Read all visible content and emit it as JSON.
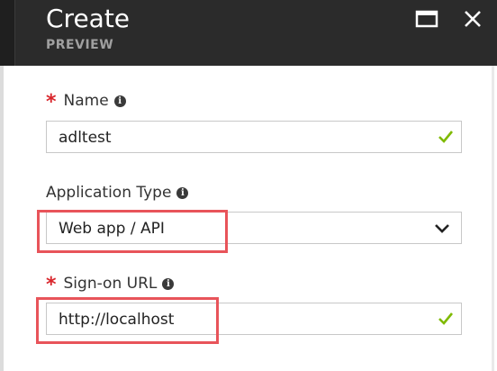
{
  "header": {
    "title": "Create",
    "subtitle": "PREVIEW"
  },
  "form": {
    "name": {
      "label": "Name",
      "required": true,
      "value": "adltest",
      "valid": true
    },
    "application_type": {
      "label": "Application Type",
      "required": false,
      "selected": "Web app / API"
    },
    "sign_on_url": {
      "label": "Sign-on URL",
      "required": true,
      "value": "http://localhost",
      "valid": true
    }
  },
  "colors": {
    "header_bg": "#2b2b2b",
    "required_asterisk": "#d9262c",
    "valid_check": "#7fba00",
    "highlight_box": "#e8545a"
  }
}
